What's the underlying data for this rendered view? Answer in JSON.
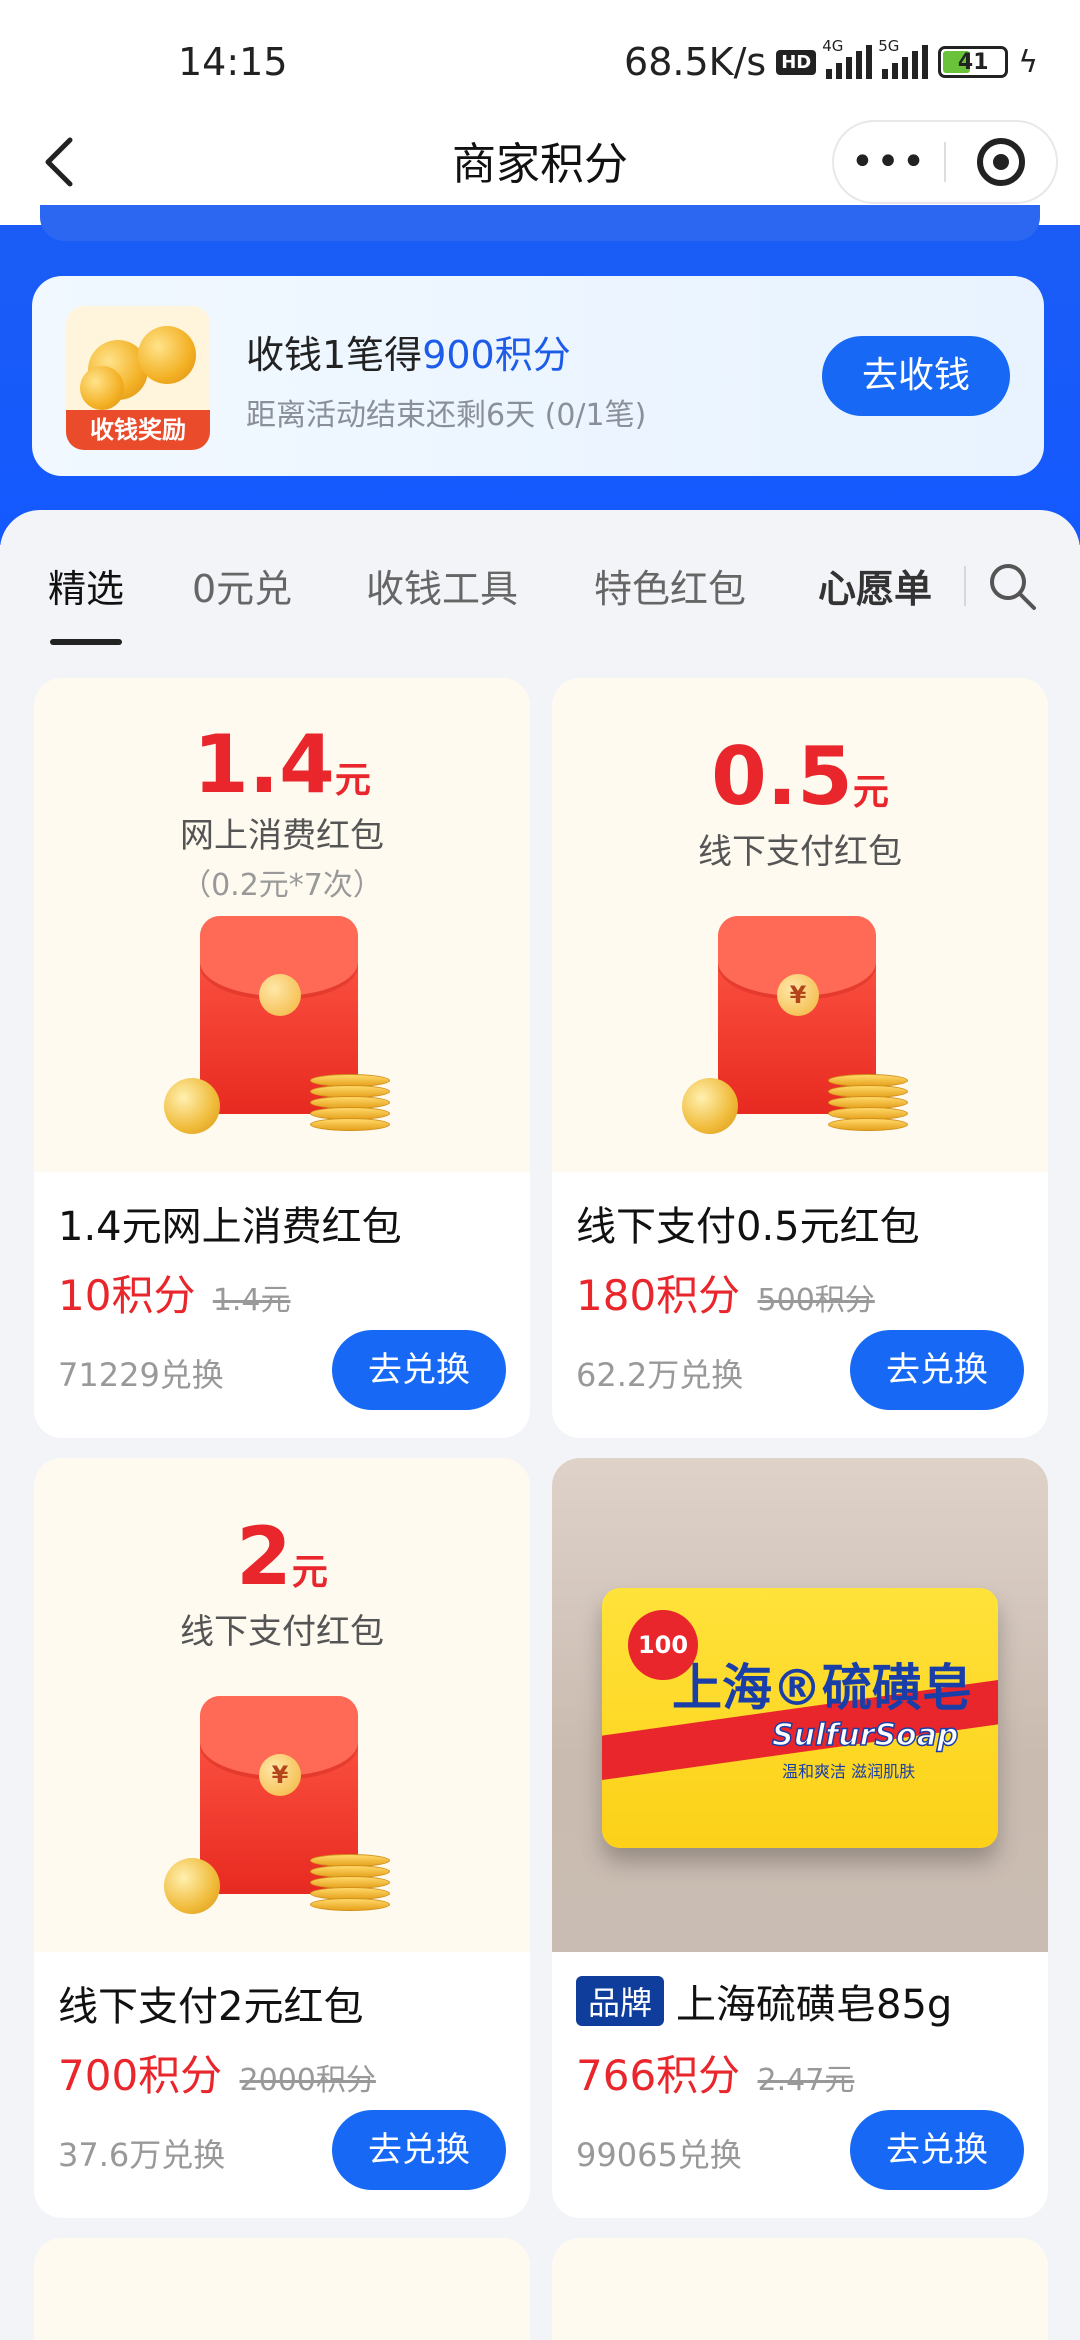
{
  "status_bar": {
    "time": "14:15",
    "net_speed": "68.5K/s",
    "hd": "HD",
    "signal1_label": "4G",
    "signal2_label": "5G",
    "battery": "41"
  },
  "nav": {
    "title": "商家积分",
    "back_icon": "chevron-left-icon",
    "more_icon": "more-dots-icon",
    "close_icon": "target-close-icon"
  },
  "promo": {
    "thumb_label": "收钱奖励",
    "title_prefix": "收钱1笔得",
    "title_highlight": "900积分",
    "subtitle": "距离活动结束还剩6天 (0/1笔)",
    "button": "去收钱"
  },
  "tabs": [
    {
      "label": "精选"
    },
    {
      "label": "0元兑"
    },
    {
      "label": "收钱工具"
    },
    {
      "label": "特色红包"
    },
    {
      "label": "心愿单"
    }
  ],
  "products": [
    {
      "hero_amount": "1.4",
      "hero_unit": "元",
      "hero_line1": "网上消费红包",
      "hero_line2": "（0.2元*7次）",
      "name": "1.4元网上消费红包",
      "price": "10积分",
      "original": "1.4元",
      "count": "71229兑换",
      "button": "去兑换"
    },
    {
      "hero_amount": "0.5",
      "hero_unit": "元",
      "hero_line1": "线下支付红包",
      "seal": "¥",
      "name": "线下支付0.5元红包",
      "price": "180积分",
      "original": "500积分",
      "count": "62.2万兑换",
      "button": "去兑换"
    },
    {
      "hero_amount": "2",
      "hero_unit": "元",
      "hero_line1": "线下支付红包",
      "seal": "¥",
      "name": "线下支付2元红包",
      "price": "700积分",
      "original": "2000积分",
      "count": "37.6万兑换",
      "button": "去兑换"
    },
    {
      "badge": "品牌",
      "name": "上海硫磺皂85g",
      "price": "766积分",
      "original": "2.47元",
      "count": "99065兑换",
      "button": "去兑换",
      "soap_cn": "上海®硫磺皂",
      "soap_en": "SulfurSoap",
      "soap_tagline": "温和爽洁 滋润肌肤",
      "soap_seal": "100"
    }
  ],
  "colors": {
    "brand_blue": "#1769f5",
    "price_red": "#e8262c",
    "band_blue": "#1459ff"
  }
}
